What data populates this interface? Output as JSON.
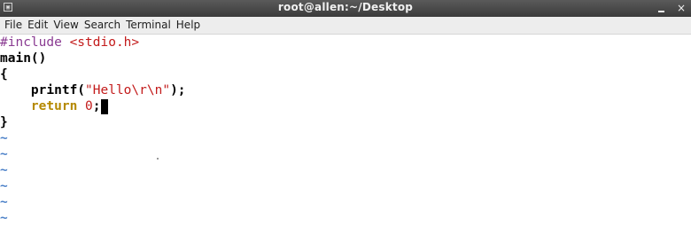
{
  "window": {
    "title": "root@allen:~/Desktop",
    "minimize_symbol": "_",
    "close_symbol": "×",
    "app_icon_glyph": "▣"
  },
  "menu": [
    "File",
    "Edit",
    "View",
    "Search",
    "Terminal",
    "Help"
  ],
  "editor": {
    "lines": [
      {
        "segments": [
          {
            "text": "#include ",
            "style": "preproc"
          },
          {
            "text": "<stdio.h>",
            "style": "str"
          }
        ]
      },
      {
        "segments": [
          {
            "text": "main()",
            "style": "bold"
          }
        ]
      },
      {
        "segments": [
          {
            "text": "{",
            "style": "bold"
          }
        ]
      },
      {
        "segments": [
          {
            "text": "    printf(",
            "style": "bold"
          },
          {
            "text": "\"Hello\\r\\n\"",
            "style": "str"
          },
          {
            "text": ");",
            "style": "bold"
          }
        ]
      },
      {
        "segments": [
          {
            "text": "    ",
            "style": "bold"
          },
          {
            "text": "return",
            "style": "kw"
          },
          {
            "text": " ",
            "style": "bold"
          },
          {
            "text": "0",
            "style": "str"
          },
          {
            "text": ";",
            "style": "bold"
          }
        ],
        "cursor": true
      },
      {
        "segments": [
          {
            "text": "}",
            "style": "bold"
          }
        ]
      }
    ],
    "empty_line_marker": "~",
    "empty_line_count": 6,
    "colors": {
      "preproc": "#8a3b92",
      "string": "#c31b1b",
      "keyword": "#b58900",
      "tilde": "#4f83c9"
    }
  }
}
